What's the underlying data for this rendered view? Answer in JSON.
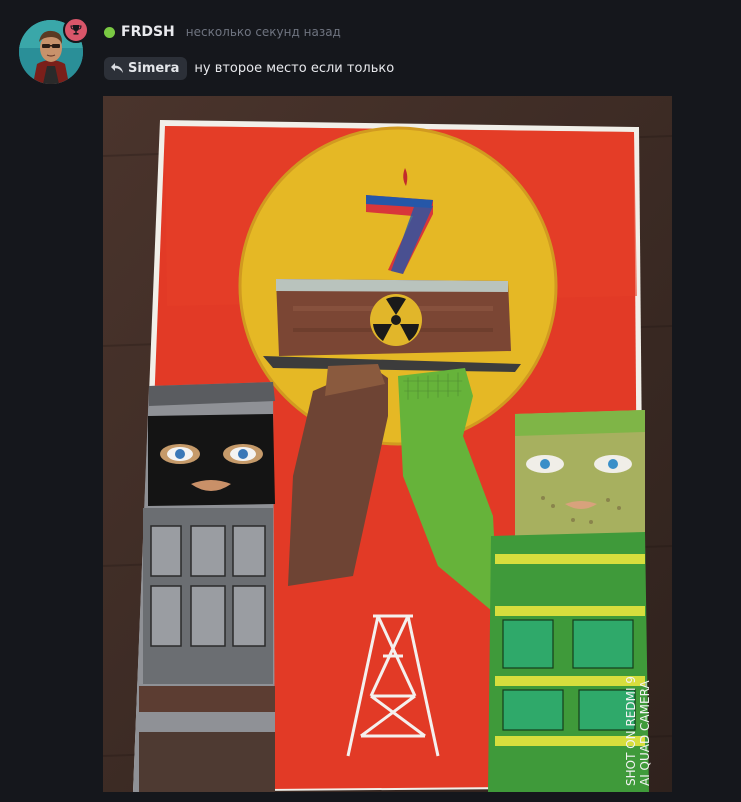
{
  "author": {
    "username": "FRDSH",
    "status": "online",
    "avatar_icon": "avatar-portrait",
    "badge_icon": "trophy-icon",
    "badge_color": "#d9566a",
    "online_color": "#7ac943"
  },
  "post": {
    "timestamp": "несколько секунд назад",
    "reply_to": "Simera",
    "reply_icon": "reply-arrow-icon",
    "text": "ну второе место если только"
  },
  "attachment": {
    "kind": "photo of children's drawing",
    "watermark_line1": "SHOT ON REDMI 9",
    "watermark_line2": "AI QUAD CAMERA",
    "poster_number": "7"
  }
}
